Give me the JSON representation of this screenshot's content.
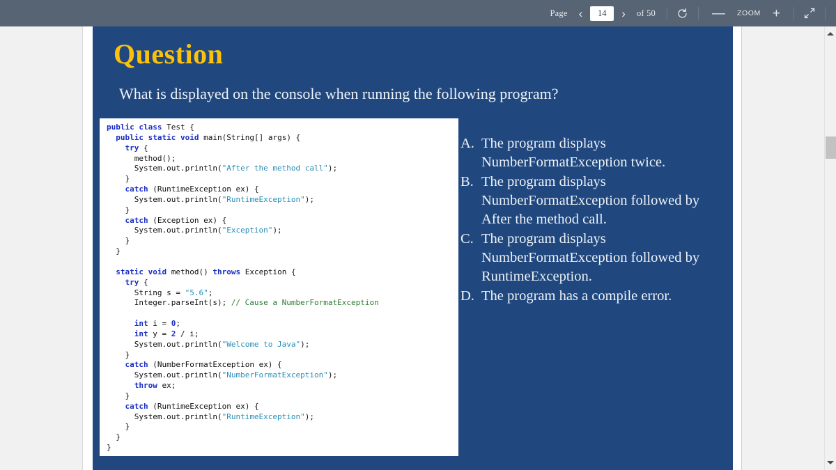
{
  "toolbar": {
    "page_label": "Page",
    "prev_icon": "chevron-left-icon",
    "page_value": "14",
    "next_icon": "chevron-right-icon",
    "of_label": "of 50",
    "reload_icon": "rotate-icon",
    "zoom_out_label": "—",
    "zoom_label": "ZOOM",
    "zoom_in_label": "+",
    "fullscreen_icon": "shrink-arrows-icon"
  },
  "slide": {
    "title": "Question",
    "subtitle": "What is displayed on the console when running the following program?",
    "title_color": "#fcc10a",
    "background_color": "#20487f",
    "text_color": "#eef2f7"
  },
  "code": {
    "lines": [
      [
        {
          "t": "public",
          "c": "kw"
        },
        {
          "t": " ",
          "c": ""
        },
        {
          "t": "class",
          "c": "kw"
        },
        {
          "t": " Test {",
          "c": ""
        }
      ],
      [
        {
          "t": "  ",
          "c": ""
        },
        {
          "t": "public",
          "c": "kw"
        },
        {
          "t": " ",
          "c": ""
        },
        {
          "t": "static",
          "c": "kw"
        },
        {
          "t": " ",
          "c": ""
        },
        {
          "t": "void",
          "c": "kw"
        },
        {
          "t": " main(String[] args) {",
          "c": ""
        }
      ],
      [
        {
          "t": "    ",
          "c": ""
        },
        {
          "t": "try",
          "c": "kw"
        },
        {
          "t": " {",
          "c": ""
        }
      ],
      [
        {
          "t": "      method();",
          "c": ""
        }
      ],
      [
        {
          "t": "      System.out.println(",
          "c": ""
        },
        {
          "t": "\"After the method call\"",
          "c": "str"
        },
        {
          "t": ");",
          "c": ""
        }
      ],
      [
        {
          "t": "    }",
          "c": ""
        }
      ],
      [
        {
          "t": "    ",
          "c": ""
        },
        {
          "t": "catch",
          "c": "kw"
        },
        {
          "t": " (RuntimeException ex) {",
          "c": ""
        }
      ],
      [
        {
          "t": "      System.out.println(",
          "c": ""
        },
        {
          "t": "\"RuntimeException\"",
          "c": "str"
        },
        {
          "t": ");",
          "c": ""
        }
      ],
      [
        {
          "t": "    }",
          "c": ""
        }
      ],
      [
        {
          "t": "    ",
          "c": ""
        },
        {
          "t": "catch",
          "c": "kw"
        },
        {
          "t": " (Exception ex) {",
          "c": ""
        }
      ],
      [
        {
          "t": "      System.out.println(",
          "c": ""
        },
        {
          "t": "\"Exception\"",
          "c": "str"
        },
        {
          "t": ");",
          "c": ""
        }
      ],
      [
        {
          "t": "    }",
          "c": ""
        }
      ],
      [
        {
          "t": "  }",
          "c": ""
        }
      ],
      [
        {
          "t": "",
          "c": ""
        }
      ],
      [
        {
          "t": "  ",
          "c": ""
        },
        {
          "t": "static",
          "c": "kw"
        },
        {
          "t": " ",
          "c": ""
        },
        {
          "t": "void",
          "c": "kw"
        },
        {
          "t": " method() ",
          "c": ""
        },
        {
          "t": "throws",
          "c": "kw"
        },
        {
          "t": " Exception {",
          "c": ""
        }
      ],
      [
        {
          "t": "    ",
          "c": ""
        },
        {
          "t": "try",
          "c": "kw"
        },
        {
          "t": " {",
          "c": ""
        }
      ],
      [
        {
          "t": "      String s = ",
          "c": ""
        },
        {
          "t": "\"5.6\"",
          "c": "str"
        },
        {
          "t": ";",
          "c": ""
        }
      ],
      [
        {
          "t": "      Integer.parseInt(s); ",
          "c": ""
        },
        {
          "t": "// Cause a NumberFormatException",
          "c": "cmt"
        }
      ],
      [
        {
          "t": "",
          "c": ""
        }
      ],
      [
        {
          "t": "      ",
          "c": ""
        },
        {
          "t": "int",
          "c": "kw"
        },
        {
          "t": " i = ",
          "c": ""
        },
        {
          "t": "0",
          "c": "num"
        },
        {
          "t": ";",
          "c": ""
        }
      ],
      [
        {
          "t": "      ",
          "c": ""
        },
        {
          "t": "int",
          "c": "kw"
        },
        {
          "t": " y = ",
          "c": ""
        },
        {
          "t": "2",
          "c": "num"
        },
        {
          "t": " / i;",
          "c": ""
        }
      ],
      [
        {
          "t": "      System.out.println(",
          "c": ""
        },
        {
          "t": "\"Welcome to Java\"",
          "c": "str"
        },
        {
          "t": ");",
          "c": ""
        }
      ],
      [
        {
          "t": "    }",
          "c": ""
        }
      ],
      [
        {
          "t": "    ",
          "c": ""
        },
        {
          "t": "catch",
          "c": "kw"
        },
        {
          "t": " (NumberFormatException ex) {",
          "c": ""
        }
      ],
      [
        {
          "t": "      System.out.println(",
          "c": ""
        },
        {
          "t": "\"NumberFormatException\"",
          "c": "str"
        },
        {
          "t": ");",
          "c": ""
        }
      ],
      [
        {
          "t": "      ",
          "c": ""
        },
        {
          "t": "throw",
          "c": "kw"
        },
        {
          "t": " ex;",
          "c": ""
        }
      ],
      [
        {
          "t": "    }",
          "c": ""
        }
      ],
      [
        {
          "t": "    ",
          "c": ""
        },
        {
          "t": "catch",
          "c": "kw"
        },
        {
          "t": " (RuntimeException ex) {",
          "c": ""
        }
      ],
      [
        {
          "t": "      System.out.println(",
          "c": ""
        },
        {
          "t": "\"RuntimeException\"",
          "c": "str"
        },
        {
          "t": ");",
          "c": ""
        }
      ],
      [
        {
          "t": "    }",
          "c": ""
        }
      ],
      [
        {
          "t": "  }",
          "c": ""
        }
      ],
      [
        {
          "t": "}",
          "c": ""
        }
      ]
    ],
    "keyword_color": "#1a2ec7",
    "string_color": "#2a8fb8",
    "comment_color": "#2e7d32",
    "background_color": "#ffffff"
  },
  "answers": [
    {
      "letter": "A.",
      "text": "The program displays NumberFormatException twice."
    },
    {
      "letter": "B.",
      "text": "The program displays NumberFormatException followed by After the method call."
    },
    {
      "letter": "C.",
      "text": "The program displays NumberFormatException followed by RuntimeException."
    },
    {
      "letter": "D.",
      "text": "The program has a compile error."
    }
  ],
  "scrollbar": {
    "up_icon": "scroll-up-arrow-icon",
    "down_icon": "scroll-down-arrow-icon"
  }
}
